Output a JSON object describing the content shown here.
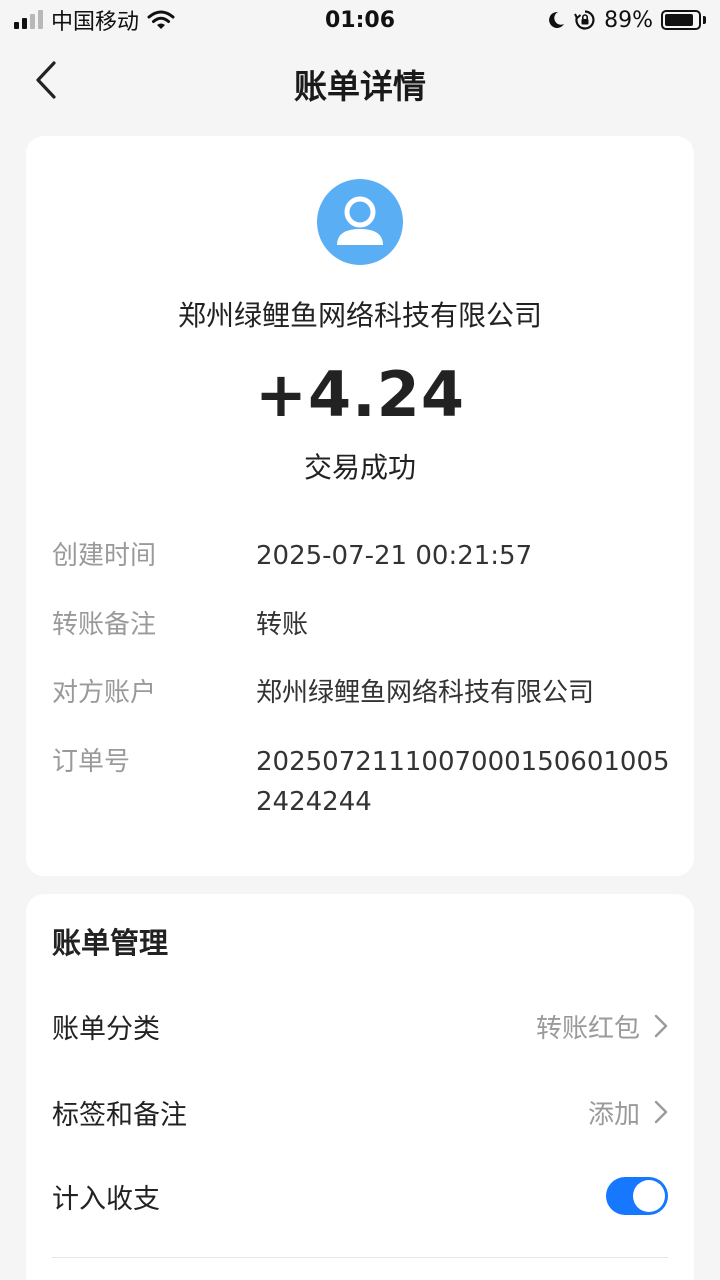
{
  "status_bar": {
    "carrier": "中国移动",
    "time": "01:06",
    "battery": "89%",
    "battery_level": 0.89,
    "icons": [
      "signal-icon",
      "wifi-icon",
      "moon-icon",
      "orientation-lock-icon",
      "battery-icon"
    ]
  },
  "nav": {
    "title": "账单详情",
    "back_icon": "chevron-left-icon"
  },
  "detail": {
    "avatar_icon": "user-icon",
    "merchant": "郑州绿鲤鱼网络科技有限公司",
    "amount": "+4.24",
    "status": "交易成功",
    "rows": [
      {
        "label": "创建时间",
        "value": "2025-07-21 00:21:57"
      },
      {
        "label": "转账备注",
        "value": "转账"
      },
      {
        "label": "对方账户",
        "value": "郑州绿鲤鱼网络科技有限公司"
      },
      {
        "label": "订单号",
        "value": "20250721110070001506010052424244"
      }
    ]
  },
  "manage": {
    "title": "账单管理",
    "category": {
      "label": "账单分类",
      "value": "转账红包"
    },
    "tags": {
      "label": "标签和备注",
      "value": "添加"
    },
    "include": {
      "label": "计入收支",
      "enabled": true
    }
  },
  "colors": {
    "accent": "#1677ff",
    "avatar_bg": "#5aaef4",
    "background": "#f5f5f5",
    "secondary_text": "#9a9a9a"
  }
}
